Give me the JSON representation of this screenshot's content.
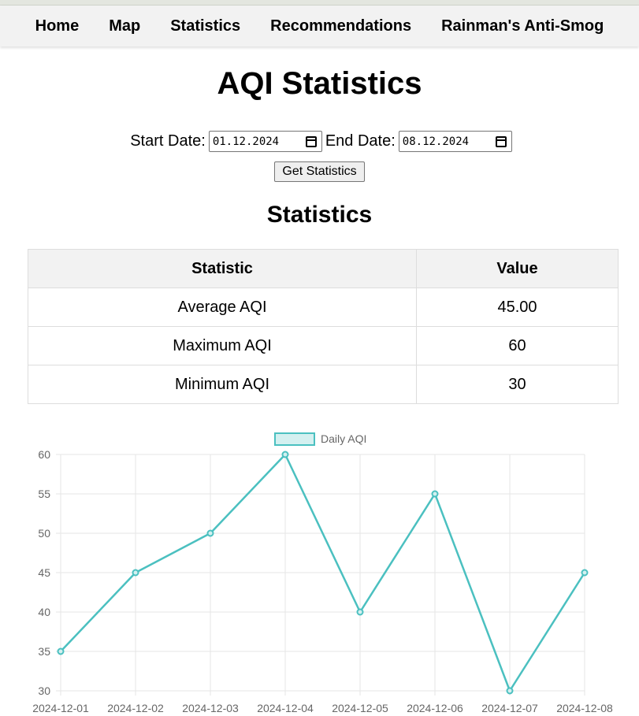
{
  "nav": {
    "items": [
      "Home",
      "Map",
      "Statistics",
      "Recommendations",
      "Rainman's Anti-Smog"
    ]
  },
  "page_title": "AQI Statistics",
  "date_form": {
    "start_label": "Start Date:",
    "start_value": "01.12.2024",
    "end_label": "End Date:",
    "end_value": "08.12.2024",
    "submit_label": "Get Statistics"
  },
  "stats": {
    "heading": "Statistics",
    "columns": [
      "Statistic",
      "Value"
    ],
    "rows": [
      [
        "Average AQI",
        "45.00"
      ],
      [
        "Maximum AQI",
        "60"
      ],
      [
        "Minimum AQI",
        "30"
      ]
    ]
  },
  "chart_data": {
    "type": "line",
    "x": [
      "2024-12-01",
      "2024-12-02",
      "2024-12-03",
      "2024-12-04",
      "2024-12-05",
      "2024-12-06",
      "2024-12-07",
      "2024-12-08"
    ],
    "series": [
      {
        "name": "Daily AQI",
        "values": [
          35,
          45,
          50,
          60,
          40,
          55,
          30,
          45
        ]
      }
    ],
    "ylim": [
      30,
      60
    ],
    "yticks": [
      30,
      35,
      40,
      45,
      50,
      55,
      60
    ],
    "grid": true,
    "legend": "top-center",
    "colors": {
      "line": "#4bc0c0",
      "legend_fill": "#d4f0f0",
      "grid": "#e5e5e5",
      "tick_text": "#666666"
    }
  }
}
